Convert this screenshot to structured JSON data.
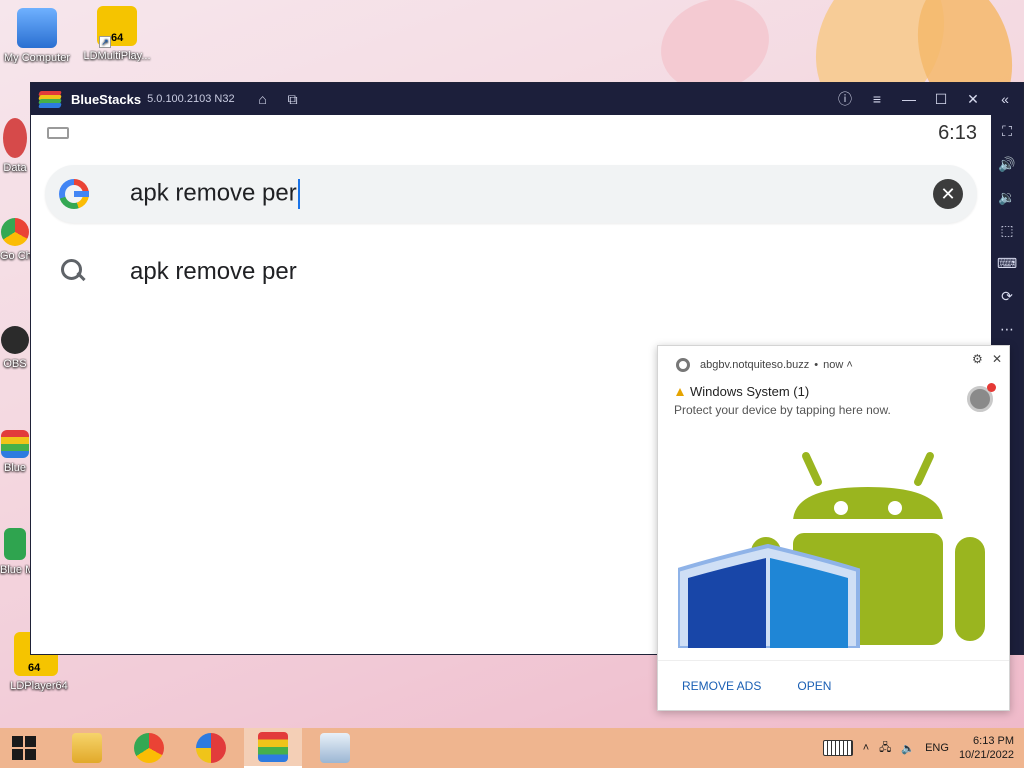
{
  "desktop": {
    "icons": [
      {
        "label": "My Computer"
      },
      {
        "label": "LDMultiPlay..."
      },
      {
        "label": "Data"
      },
      {
        "label": "Go Ch"
      },
      {
        "label": "OBS"
      },
      {
        "label": "Blue"
      },
      {
        "label": "Blue Multi"
      },
      {
        "label": "LDPlayer64"
      }
    ],
    "badge_64": "64"
  },
  "bluestacks": {
    "title": "BlueStacks",
    "version": "5.0.100.2103 N32"
  },
  "android": {
    "clock": "6:13",
    "search": {
      "query": "apk remove per"
    },
    "suggestions": [
      {
        "text": "apk remove per"
      }
    ]
  },
  "notification": {
    "source": "abgbv.notquiteso.buzz",
    "time": "now",
    "title": "Windows System (1)",
    "body": "Protect your device by tapping here now.",
    "actions": {
      "remove_ads": "REMOVE ADS",
      "open": "OPEN"
    }
  },
  "taskbar": {
    "language": "ENG",
    "time": "6:13 PM",
    "date": "10/21/2022"
  },
  "colors": {
    "bluestacks_bar": "#1c1f3b",
    "taskbar": "#efb58f",
    "android_green": "#9ab51f",
    "shield_blue": "#1846a8"
  }
}
